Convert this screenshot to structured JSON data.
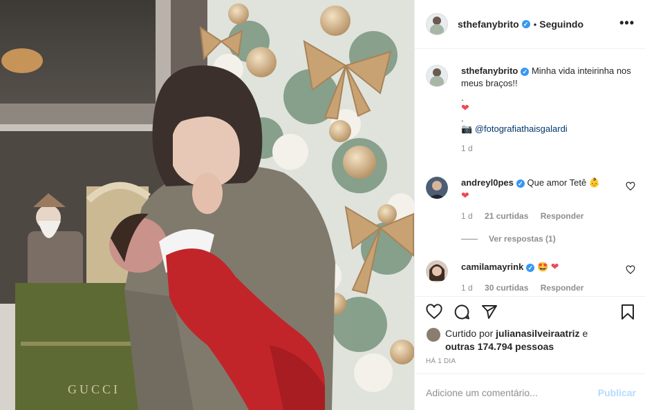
{
  "post": {
    "author": "sthefanybrito",
    "dot": "•",
    "follow_status": "Seguindo",
    "more": "•••",
    "photo_print": "GUCCI"
  },
  "caption": {
    "author": "sthefanybrito",
    "text": "Minha vida inteirinha nos meus braços!!",
    "line_dot1": ".",
    "heart": "❤",
    "line_dot2": ".",
    "camera": "📷",
    "credit": "@fotografiathaisgalardi",
    "time": "1 d"
  },
  "comments": [
    {
      "user": "andreyl0pes",
      "text": "Que amor Tetê",
      "emoji": "👶",
      "heart": "❤",
      "time": "1 d",
      "likes": "21 curtidas",
      "reply": "Responder"
    },
    {
      "user": "camilamayrink",
      "emoji1": "🤩",
      "emoji2": "❤",
      "time": "1 d",
      "likes": "30 curtidas",
      "reply": "Responder"
    }
  ],
  "view_replies": "Ver respostas (1)",
  "liked_by": {
    "prefix": "Curtido por",
    "user": "julianasilveiraatriz",
    "conj": "e",
    "others": "outras 174.794 pessoas"
  },
  "timestamp": "HÁ 1 DIA",
  "add_comment": {
    "placeholder": "Adicione um comentário...",
    "publish": "Publicar"
  },
  "colors": {
    "verified": "#3897f0",
    "heart": "#ed4956",
    "publish_disabled": "#b3dbff",
    "muted": "#8e8e8e"
  }
}
